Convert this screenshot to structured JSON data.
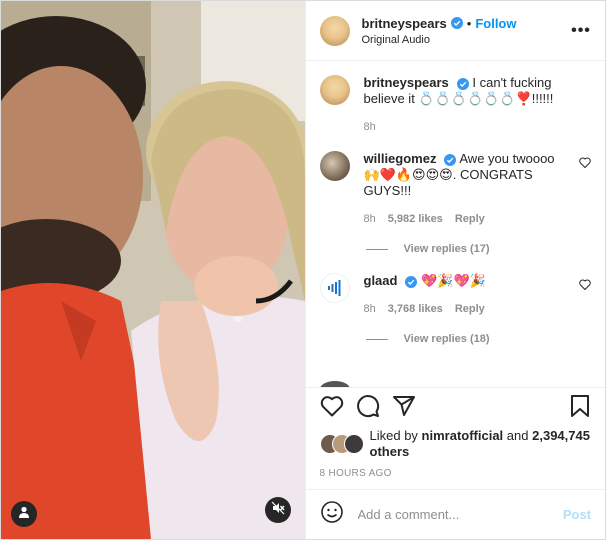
{
  "post": {
    "username": "britneyspears",
    "follow_label": "Follow",
    "separator": "•",
    "audio": "Original Audio",
    "more_label": "•••"
  },
  "caption": {
    "username": "britneyspears",
    "text": "I can't fucking believe it 💍💍💍💍💍💍❣️!!!!!!",
    "time": "8h"
  },
  "comments": [
    {
      "username": "williegomez",
      "text": "Awe you twoooo 🙌❤️🔥😍😍😍. CONGRATS GUYS!!!",
      "time": "8h",
      "likes": "5,982 likes",
      "reply_label": "Reply",
      "view_replies": "View replies (17)"
    },
    {
      "username": "glaad",
      "text": "💖🎉💖🎉",
      "time": "8h",
      "likes": "3,768 likes",
      "reply_label": "Reply",
      "view_replies": "View replies (18)"
    }
  ],
  "likes": {
    "prefix": "Liked by",
    "user": "nimratofficial",
    "and": "and",
    "others": "2,394,745 others"
  },
  "timestamp": "8 HOURS AGO",
  "composer": {
    "placeholder": "Add a comment...",
    "post_label": "Post"
  },
  "icons": {
    "like": "heart-icon",
    "comment": "comment-icon",
    "share": "share-icon",
    "save": "bookmark-icon",
    "emoji": "emoji-icon",
    "tag": "user-tag-icon",
    "mute": "muted-speaker-icon"
  },
  "colors": {
    "accent": "#0095f6",
    "verified": "#3897f0",
    "muted_text": "#8e8e8e",
    "post_disabled": "#b2dffc"
  }
}
